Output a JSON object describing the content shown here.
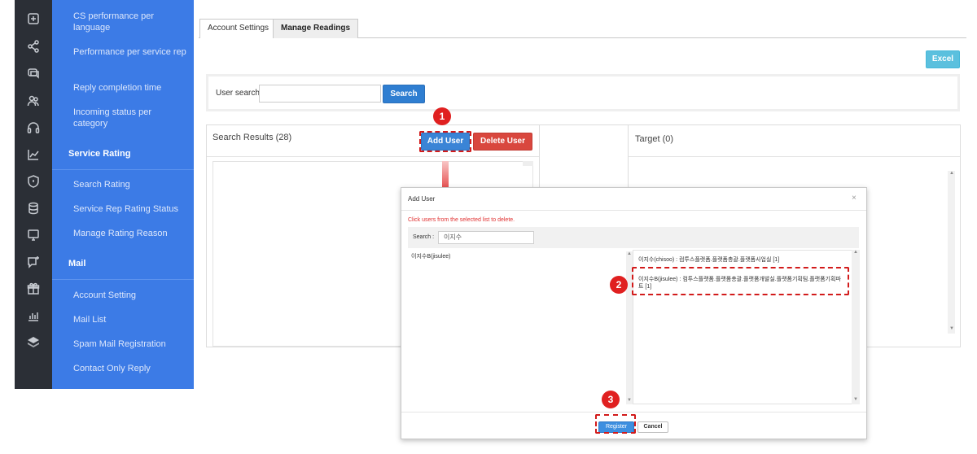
{
  "nav": {
    "items_top": [
      {
        "label": "CS performance per language"
      },
      {
        "label": "Performance per service rep"
      },
      {
        "label": "Reply completion time"
      },
      {
        "label": "Incoming status per category"
      }
    ],
    "service_rating": {
      "title": "Service Rating",
      "items": [
        "Search Rating",
        "Service Rep Rating Status",
        "Manage Rating Reason"
      ]
    },
    "mail": {
      "title": "Mail",
      "items": [
        "Account Setting",
        "Mail List",
        "Spam Mail Registration",
        "Contact Only Reply"
      ]
    }
  },
  "rail_icons": [
    "plus-square-icon",
    "share-icon",
    "chat-icon",
    "users-icon",
    "headset-icon",
    "chart-line-icon",
    "shield-icon",
    "database-icon",
    "monitor-icon",
    "chat-plus-icon",
    "gift-icon",
    "bar-chart-icon",
    "layers-icon"
  ],
  "tabs": [
    {
      "label": "Account Settings",
      "active": false
    },
    {
      "label": "Manage Readings",
      "active": true
    }
  ],
  "toolbar": {
    "excel_label": "Excel"
  },
  "user_search": {
    "label": "User search",
    "input_value": "",
    "button_label": "Search"
  },
  "results": {
    "title": "Search Results (28)",
    "add_user_label": "Add User",
    "delete_user_label": "Delete User"
  },
  "target": {
    "title": "Target (0)"
  },
  "modal": {
    "title": "Add User",
    "close": "×",
    "notice": "Click users from the selected list to delete.",
    "search_label": "Search :",
    "search_value": "이지수",
    "left_list": [
      "이지수B(jisulee)"
    ],
    "right_list": [
      "이지수(chisoo) : 컴투스플랫폼.플랫폼총괄.플랫폼사업실 [1]",
      "이지수B(jisulee) : 컴투스플랫폼.플랫폼총괄.플랫폼개발실.플랫폼기획팀.플랫폼기획파트 [1]"
    ],
    "register_label": "Register",
    "cancel_label": "Cancel"
  },
  "callouts": [
    "1",
    "2",
    "3"
  ],
  "colors": {
    "nav_blue": "#3c7be6",
    "rail_dark": "#2b2f36",
    "callout_red": "#e02020",
    "primary": "#2f7ed1",
    "danger": "#d9473e",
    "excel": "#5bc0de"
  }
}
